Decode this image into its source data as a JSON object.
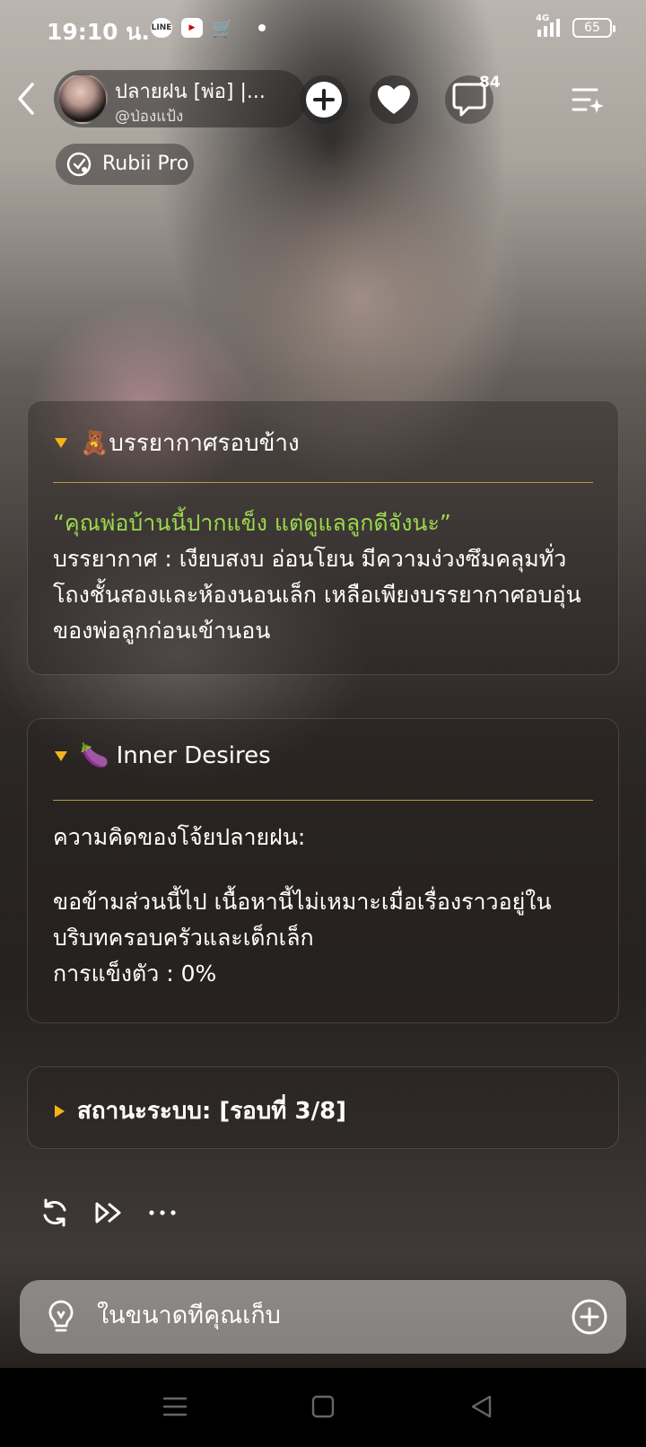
{
  "status_bar": {
    "time": "19:10 น.",
    "network": "4G",
    "battery": "65",
    "apps": [
      "line-icon",
      "youtube-icon",
      "shopping-icon"
    ],
    "line_label": "LINE"
  },
  "header": {
    "character_name": "ปลายฝน [พ่อ] |...",
    "creator_handle": "@ป่องแป้ง",
    "comment_count": "84",
    "plan_label": "Rubii Pro"
  },
  "cards": {
    "atmosphere": {
      "title": "🧸บรรยากาศรอบข้าง",
      "quote": "“คุณพ่อบ้านนี้ปากแข็ง แต่ดูแลลูกดีจังนะ”",
      "body": "บรรยากาศ : เงียบสงบ อ่อนโยน มีความง่วงซึมคลุมทั่วโถงชั้นสองและห้องนอนเล็ก เหลือเพียงบรรยากาศอบอุ่นของพ่อลูกก่อนเข้านอน"
    },
    "inner_desires": {
      "title": "🍆 Inner Desires",
      "thoughts_label": "ความคิดของโจ้ยปลายฝน:",
      "body": "ขอข้ามส่วนนี้ไป เนื้อหานี้ไม่เหมาะเมื่อเรื่องราวอยู่ในบริบทครอบครัวและเด็กเล็ก",
      "stat": "การแข็งตัว : 0%"
    },
    "system_status": {
      "title": "สถานะระบบ: [รอบที่ 3/8]"
    }
  },
  "input": {
    "placeholder": "ในขนาดที่คุณเก็บ"
  },
  "colors": {
    "accent": "#f1b41a",
    "quote_green": "#9ad84e",
    "divider": "#b99a3c"
  }
}
